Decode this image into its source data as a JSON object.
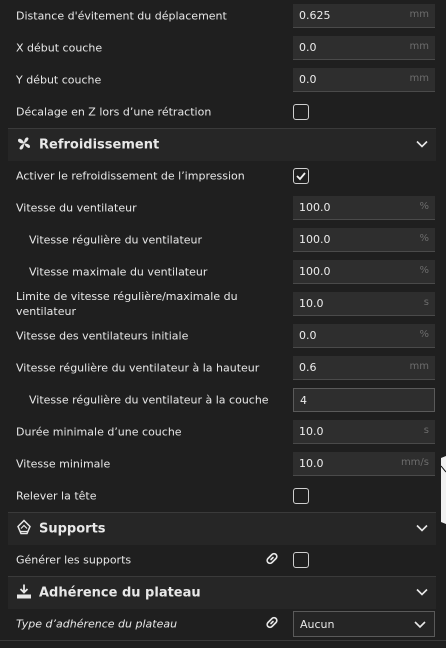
{
  "settings_top": [
    {
      "label": "Distance d'évitement du déplacement",
      "value": "0.625",
      "unit": "mm"
    },
    {
      "label": "X début couche",
      "value": "0.0",
      "unit": "mm"
    },
    {
      "label": "Y début couche",
      "value": "0.0",
      "unit": "mm"
    }
  ],
  "zhop": {
    "label": "Décalage en Z lors d’une rétraction",
    "checked": false
  },
  "cooling": {
    "title": "Refroidissement",
    "enable": {
      "label": "Activer le refroidissement de l’impression",
      "checked": true
    },
    "fan_speed": {
      "label": "Vitesse du ventilateur",
      "value": "100.0",
      "unit": "%"
    },
    "fan_regular": {
      "label": "Vitesse régulière du ventilateur",
      "value": "100.0",
      "unit": "%"
    },
    "fan_max": {
      "label": "Vitesse maximale du ventilateur",
      "value": "100.0",
      "unit": "%"
    },
    "fan_threshold": {
      "label": "Limite de vitesse régulière/maximale du ventilateur",
      "value": "10.0",
      "unit": "s"
    },
    "fan_initial": {
      "label": "Vitesse des ventilateurs initiale",
      "value": "0.0",
      "unit": "%"
    },
    "fan_height": {
      "label": "Vitesse régulière du ventilateur à la hauteur",
      "value": "0.6",
      "unit": "mm"
    },
    "fan_layer": {
      "label": "Vitesse régulière du ventilateur à la couche",
      "value": "4",
      "unit": ""
    },
    "min_layer_time": {
      "label": "Durée minimale d’une couche",
      "value": "10.0",
      "unit": "s"
    },
    "min_speed": {
      "label": "Vitesse minimale",
      "value": "10.0",
      "unit": "mm/s"
    },
    "lift_head": {
      "label": "Relever la tête",
      "checked": false
    }
  },
  "supports": {
    "title": "Supports",
    "generate": {
      "label": "Générer les supports",
      "checked": false
    }
  },
  "adhesion": {
    "title": "Adhérence du plateau",
    "type": {
      "label": "Type d’adhérence du plateau",
      "value": "Aucun"
    }
  }
}
